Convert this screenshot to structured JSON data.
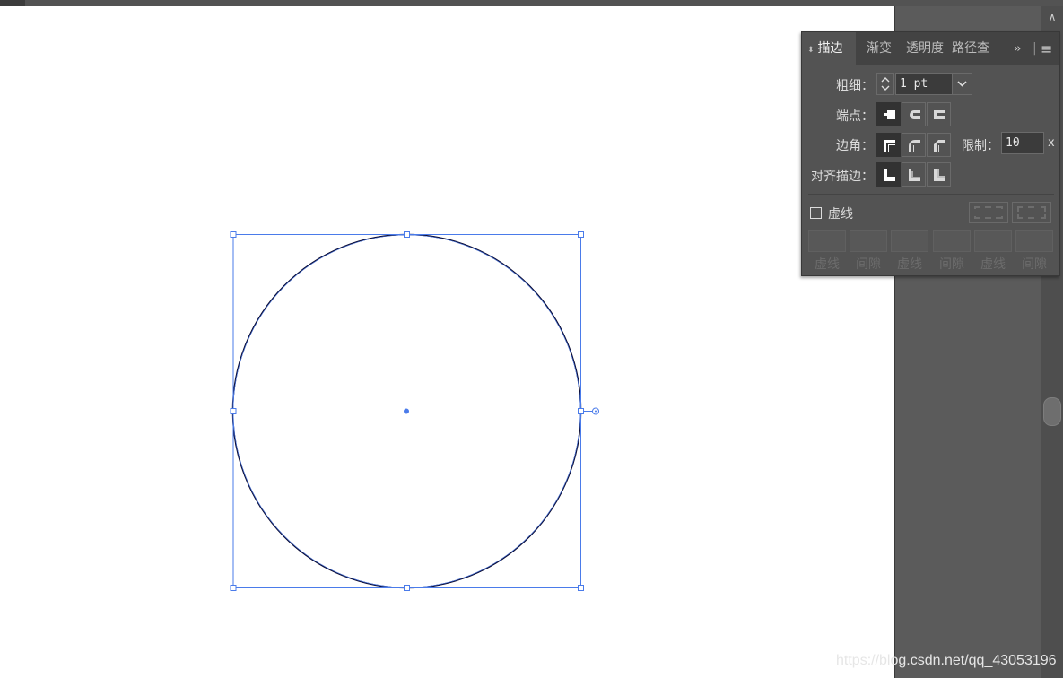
{
  "panel": {
    "tabs": [
      {
        "label": "描边",
        "active": true
      },
      {
        "label": "渐变",
        "active": false
      },
      {
        "label": "透明度",
        "active": false
      },
      {
        "label": "路径查找器",
        "active": false
      }
    ],
    "overflow_icon": "double-chevron-right-icon",
    "menu_icon": "hamburger-menu-icon",
    "weight": {
      "label": "粗细：",
      "value": "1 pt"
    },
    "cap": {
      "label": "端点：",
      "selected": "butt-cap"
    },
    "corner": {
      "label": "边角：",
      "selected": "miter-join"
    },
    "limit": {
      "label": "限制：",
      "value": "10",
      "unit": "x"
    },
    "align": {
      "label": "对齐描边：",
      "selected": "center"
    },
    "dashed": {
      "label": "虚线",
      "checked": false
    },
    "dash_fields": [
      "虚线",
      "间隙",
      "虚线",
      "间隙",
      "虚线",
      "间隙"
    ]
  },
  "watermark": "https://blog.csdn.net/qq_43053196",
  "colors": {
    "selection": "#4a7bea",
    "stroke": "#0a0a30",
    "panel_bg": "#535353"
  }
}
